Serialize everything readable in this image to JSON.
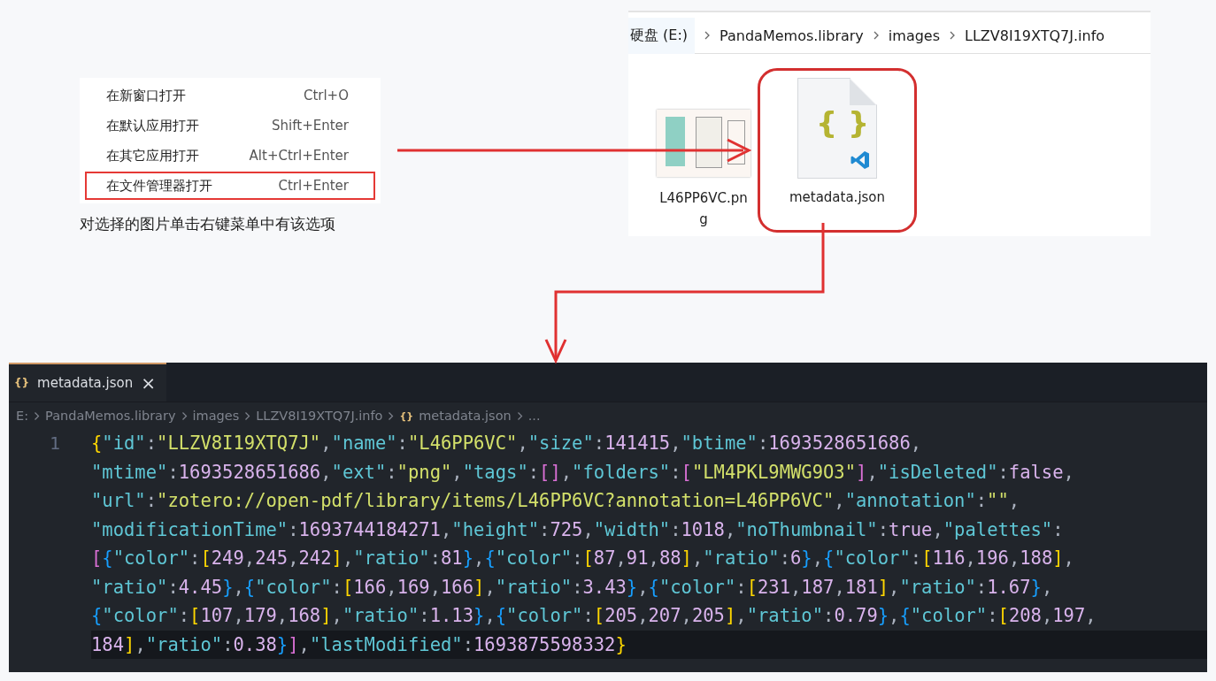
{
  "context_menu": {
    "items": [
      {
        "label": "在新窗口打开",
        "shortcut": "Ctrl+O",
        "highlighted": false
      },
      {
        "label": "在默认应用打开",
        "shortcut": "Shift+Enter",
        "highlighted": false
      },
      {
        "label": "在其它应用打开",
        "shortcut": "Alt+Ctrl+Enter",
        "highlighted": false
      },
      {
        "label": "在文件管理器打开",
        "shortcut": "Ctrl+Enter",
        "highlighted": true
      }
    ],
    "caption": "对选择的图片单击右键菜单中有该选项"
  },
  "explorer": {
    "breadcrumb": [
      "硬盘 (E:)",
      "PandaMemos.library",
      "images",
      "LLZV8I19XTQ7J.info"
    ],
    "files": [
      {
        "kind": "image",
        "name": "L46PP6VC.png",
        "highlighted": false
      },
      {
        "kind": "json",
        "name": "metadata.json",
        "badge": "{ }",
        "highlighted": true
      }
    ]
  },
  "editor": {
    "tabs": [
      {
        "icon": "{}",
        "label": "metadata.json",
        "close": "×",
        "selected": true
      }
    ],
    "breadcrumb": [
      {
        "label": "E:"
      },
      {
        "label": "PandaMemos.library"
      },
      {
        "label": "images"
      },
      {
        "label": "LLZV8I19XTQ7J.info"
      },
      {
        "label": "metadata.json",
        "icon": "{}"
      },
      {
        "label": "..."
      }
    ],
    "line_number": "1",
    "lines": [
      {
        "text": "{\"id\":\"LLZV8I19XTQ7J\",\"name\":\"L46PP6VC\",\"size\":141415,\"btime\":1693528651686,",
        "current": false
      },
      {
        "text": "\"mtime\":1693528651686,\"ext\":\"png\",\"tags\":[],\"folders\":[\"LM4PKL9MWG9O3\"],\"isDeleted\":false,",
        "current": false
      },
      {
        "text": "\"url\":\"zotero://open-pdf/library/items/L46PP6VC?annotation=L46PP6VC\",\"annotation\":\"\",",
        "current": false
      },
      {
        "text": "\"modificationTime\":1693744184271,\"height\":725,\"width\":1018,\"noThumbnail\":true,\"palettes\":",
        "current": false
      },
      {
        "text": "[{\"color\":[249,245,242],\"ratio\":81},{\"color\":[87,91,88],\"ratio\":6},{\"color\":[116,196,188],",
        "current": false
      },
      {
        "text": "\"ratio\":4.45},{\"color\":[166,169,166],\"ratio\":3.43},{\"color\":[231,187,181],\"ratio\":1.67},",
        "current": false
      },
      {
        "text": "{\"color\":[107,179,168],\"ratio\":1.13},{\"color\":[205,207,205],\"ratio\":0.79},{\"color\":[208,197,",
        "current": false
      },
      {
        "text": "184],\"ratio\":0.38}],\"lastModified\":1693875598332}",
        "current": true
      }
    ]
  }
}
